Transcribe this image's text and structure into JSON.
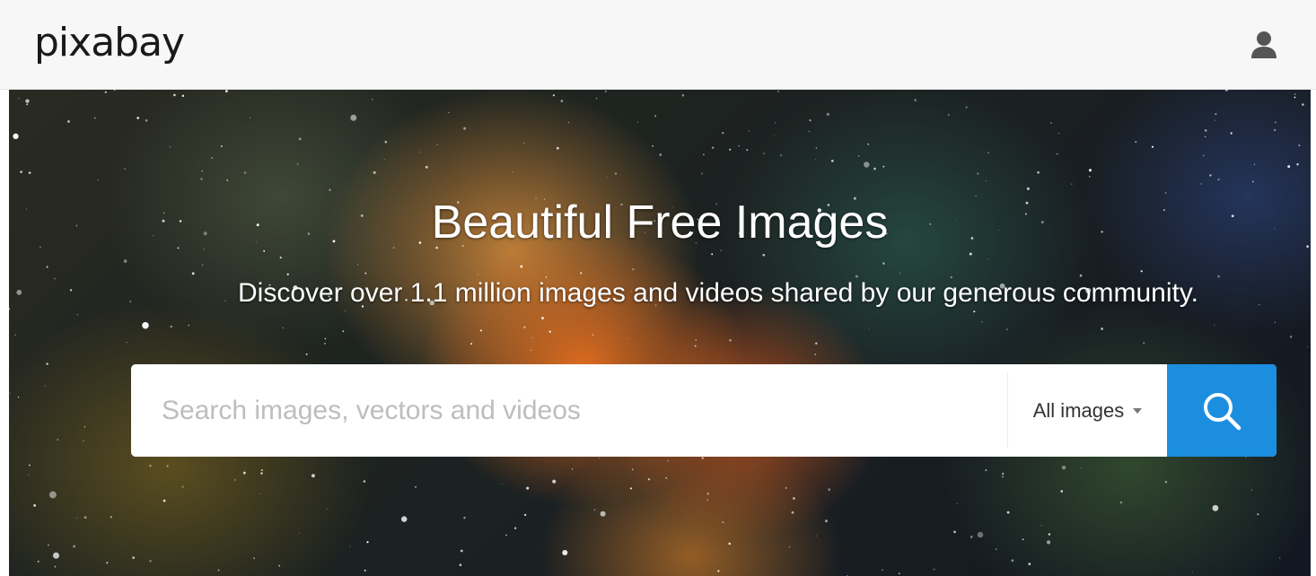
{
  "header": {
    "logo_text": "pixabay",
    "user_icon": "user-icon"
  },
  "hero": {
    "title": "Beautiful Free Images",
    "subtitle": "Discover over 1.1 million images and videos shared by our generous community."
  },
  "search": {
    "placeholder": "Search images, vectors and videos",
    "value": "",
    "type_selected": "All images",
    "type_caret_icon": "caret-down-icon",
    "button_icon": "search-icon"
  },
  "colors": {
    "topbar_bg": "#f7f7f7",
    "accent": "#1c8ee0",
    "text_dark": "#1a1a1a",
    "placeholder": "#bdbdbd"
  }
}
